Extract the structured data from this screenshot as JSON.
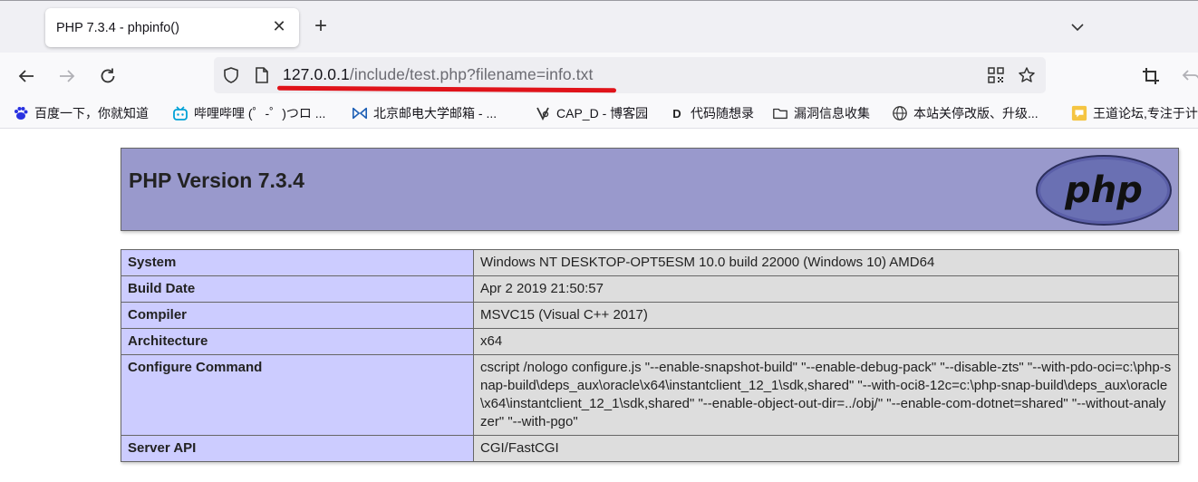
{
  "tab": {
    "title": "PHP 7.3.4 - phpinfo()",
    "close_symbol": "✕",
    "new_tab_symbol": "+"
  },
  "url": {
    "host": "127.0.0.1",
    "path": "/include/test.php?filename=info.txt"
  },
  "bookmarks": [
    {
      "label": "百度一下，你就知道",
      "icon": "baidu-icon"
    },
    {
      "label": "哔哩哔哩 (゜-゜)つロ ...",
      "icon": "bilibili-icon"
    },
    {
      "label": "北京邮电大学邮箱 - ...",
      "icon": "bupt-mail-icon"
    },
    {
      "label": "CAP_D - 博客园",
      "icon": "cnblogs-icon"
    },
    {
      "label": "代码随想录",
      "icon": "code-icon"
    },
    {
      "label": "漏洞信息收集",
      "icon": "folder-icon"
    },
    {
      "label": "本站关停改版、升级...",
      "icon": "globe-icon"
    },
    {
      "label": "王道论坛,专注于计",
      "icon": "wangdao-icon"
    }
  ],
  "phpinfo": {
    "version_title": "PHP Version 7.3.4",
    "logo_text": "php",
    "rows": [
      {
        "key": "System",
        "value": "Windows NT DESKTOP-OPT5ESM 10.0 build 22000 (Windows 10) AMD64"
      },
      {
        "key": "Build Date",
        "value": "Apr 2 2019 21:50:57"
      },
      {
        "key": "Compiler",
        "value": "MSVC15 (Visual C++ 2017)"
      },
      {
        "key": "Architecture",
        "value": "x64"
      },
      {
        "key": "Configure Command",
        "value": "cscript /nologo configure.js \"--enable-snapshot-build\" \"--enable-debug-pack\" \"--disable-zts\" \"--with-pdo-oci=c:\\php-snap-build\\deps_aux\\oracle\\x64\\instantclient_12_1\\sdk,shared\" \"--with-oci8-12c=c:\\php-snap-build\\deps_aux\\oracle\\x64\\instantclient_12_1\\sdk,shared\" \"--enable-object-out-dir=../obj/\" \"--enable-com-dotnet=shared\" \"--without-analyzer\" \"--with-pgo\""
      },
      {
        "key": "Server API",
        "value": "CGI/FastCGI"
      }
    ]
  },
  "colors": {
    "header_bg": "#9999cc",
    "key_bg": "#ccccff",
    "value_bg": "#dddddd",
    "underline": "#e0131a"
  }
}
